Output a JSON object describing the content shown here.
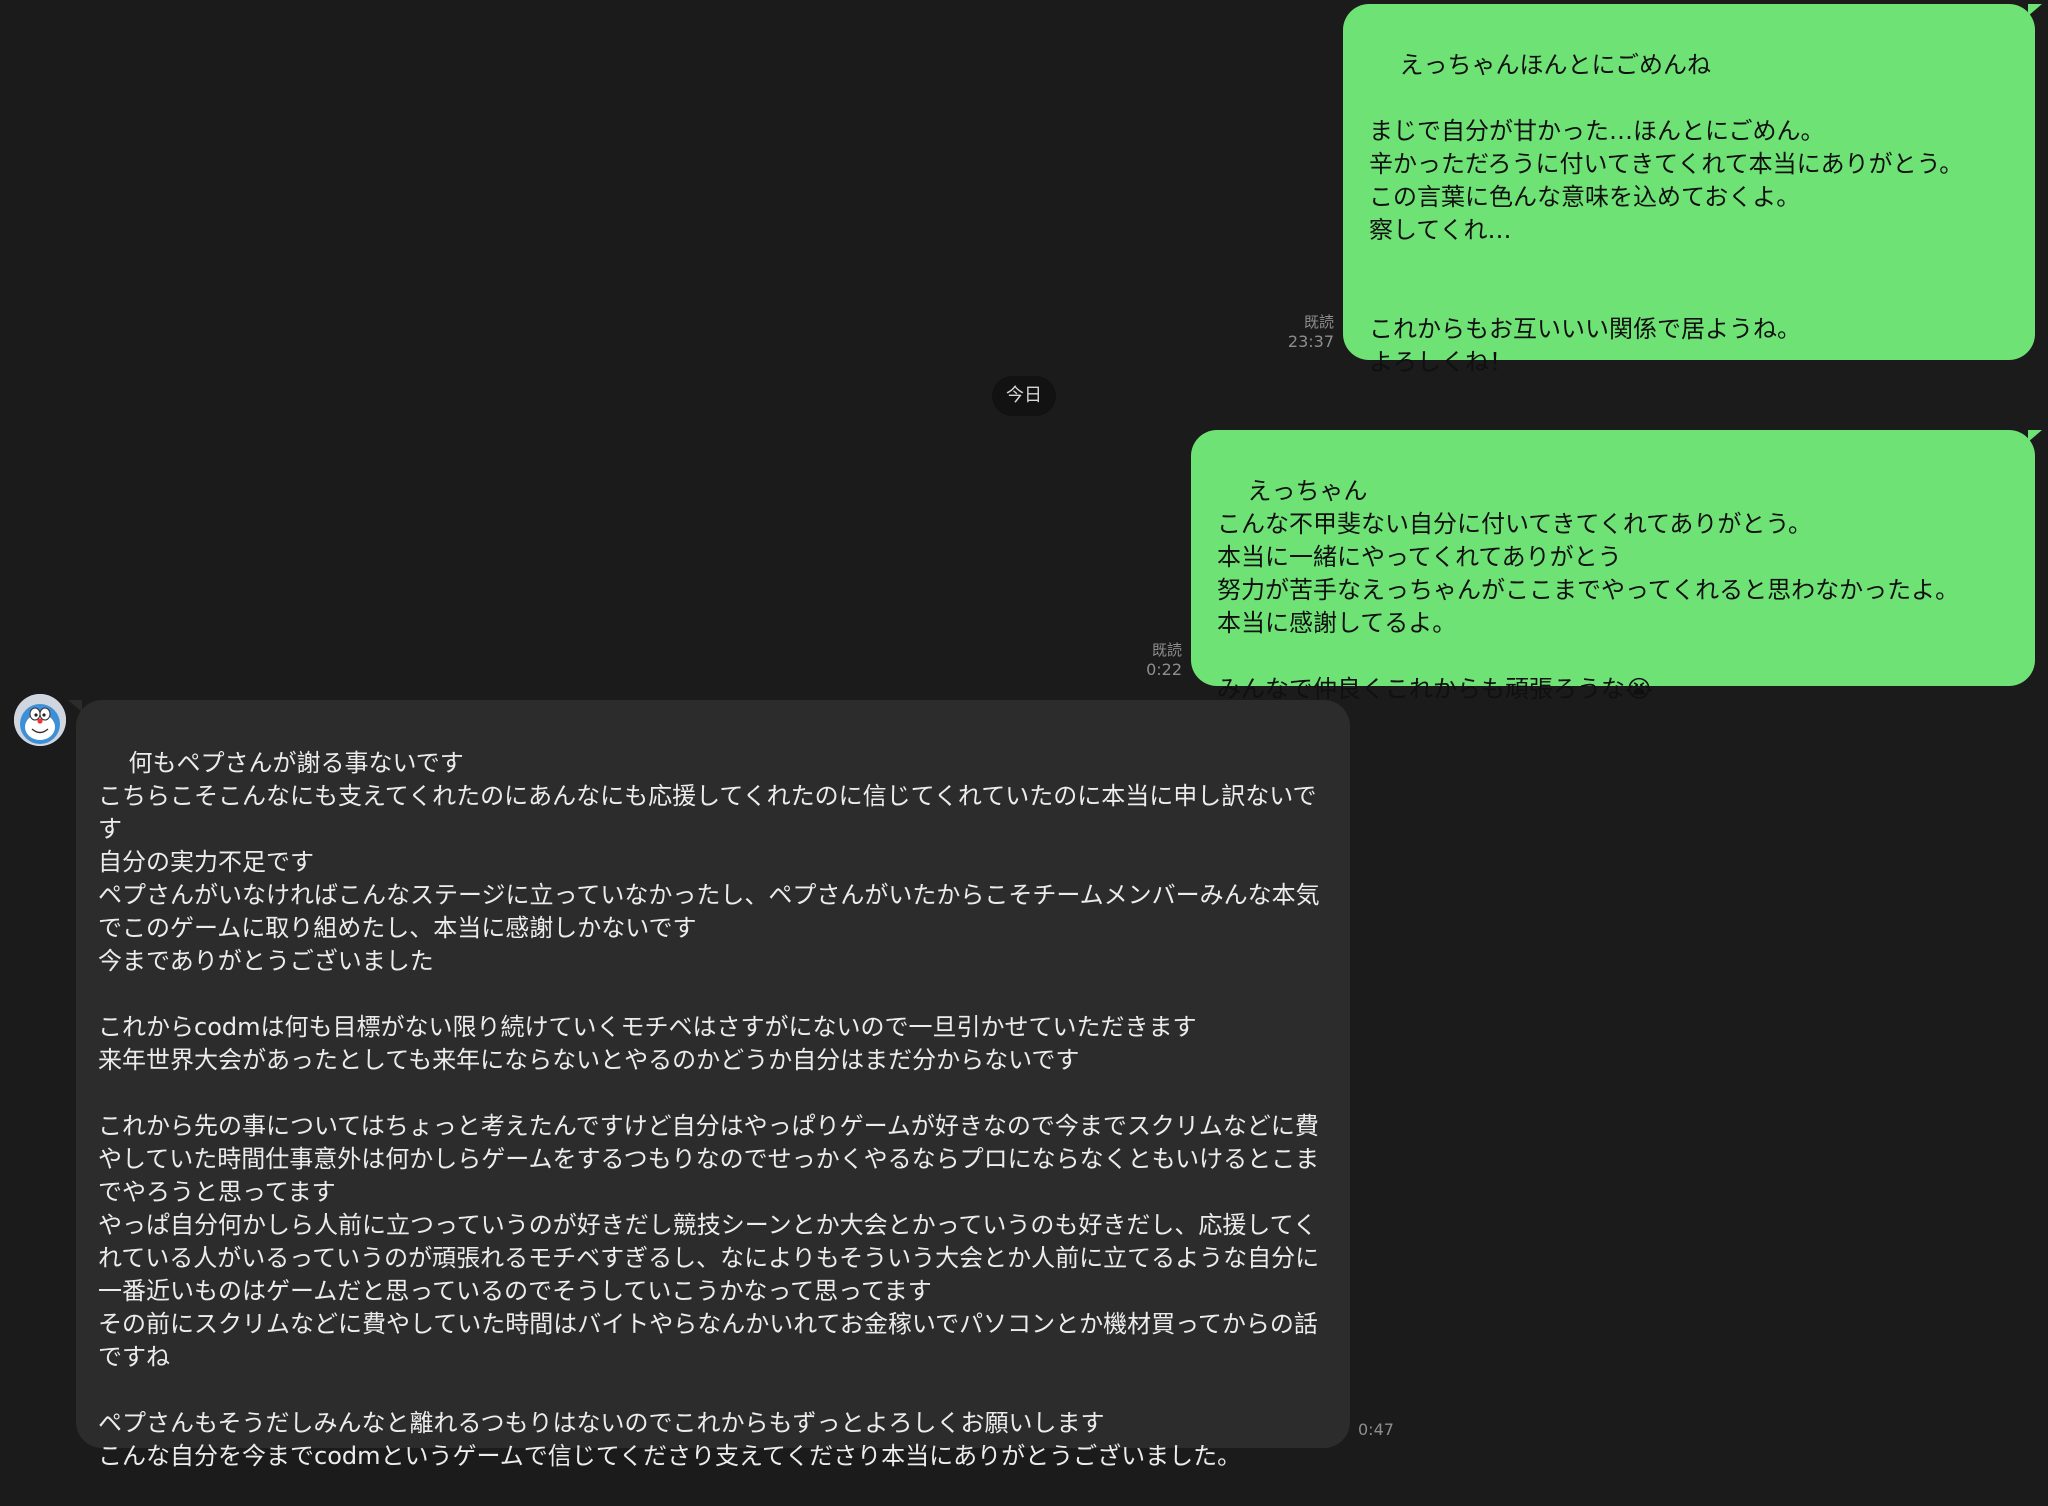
{
  "conversation": {
    "date_separator": "今日",
    "messages": [
      {
        "id": "m1",
        "direction": "outgoing",
        "text": "えっちゃんほんとにごめんね\n\nまじで自分が甘かった…ほんとにごめん。\n辛かっただろうに付いてきてくれて本当にありがとう。\nこの言葉に色んな意味を込めておくよ。\n察してくれ…\n\n\nこれからもお互いいい関係で居ようね。\nよろしくね！",
        "read_label": "既読",
        "time": "23:37"
      },
      {
        "id": "m2",
        "direction": "outgoing",
        "text": "えっちゃん\nこんな不甲斐ない自分に付いてきてくれてありがとう。\n本当に一緒にやってくれてありがとう\n努力が苦手なえっちゃんがここまでやってくれると思わなかったよ。\n本当に感謝してるよ。\n\nみんなで仲良くこれからも頑張ろうな😭",
        "read_label": "既読",
        "time": "0:22"
      },
      {
        "id": "m3",
        "direction": "incoming",
        "avatar_icon": "doraemon-avatar-icon",
        "text": "何もペプさんが謝る事ないです\nこちらこそこんなにも支えてくれたのにあんなにも応援してくれたのに信じてくれていたのに本当に申し訳ないです\n自分の実力不足です\nペプさんがいなければこんなステージに立っていなかったし、ペプさんがいたからこそチームメンバーみんな本気でこのゲームに取り組めたし、本当に感謝しかないです\n今までありがとうございました\n\nこれからcodmは何も目標がない限り続けていくモチベはさすがにないので一旦引かせていただきます\n来年世界大会があったとしても来年にならないとやるのかどうか自分はまだ分からないです\n\nこれから先の事についてはちょっと考えたんですけど自分はやっぱりゲームが好きなので今までスクリムなどに費やしていた時間仕事意外は何かしらゲームをするつもりなのでせっかくやるならプロにならなくともいけるとこまでやろうと思ってます\nやっぱ自分何かしら人前に立つっていうのが好きだし競技シーンとか大会とかっていうのも好きだし、応援してくれている人がいるっていうのが頑張れるモチベすぎるし、なによりもそういう大会とか人前に立てるような自分に一番近いものはゲームだと思っているのでそうしていこうかなって思ってます\nその前にスクリムなどに費やしていた時間はバイトやらなんかいれてお金稼いでパソコンとか機材買ってからの話ですね\n\nペプさんもそうだしみんなと離れるつもりはないのでこれからもずっとよろしくお願いします\nこんな自分を今までcodmというゲームで信じてくださり支えてくださり本当にありがとうございました。",
        "time": "0:47"
      }
    ]
  },
  "colors": {
    "background": "#1b1b1b",
    "outgoing_bubble": "#6fe276",
    "incoming_bubble": "#2c2c2c",
    "meta_text": "#8e8e8e"
  }
}
